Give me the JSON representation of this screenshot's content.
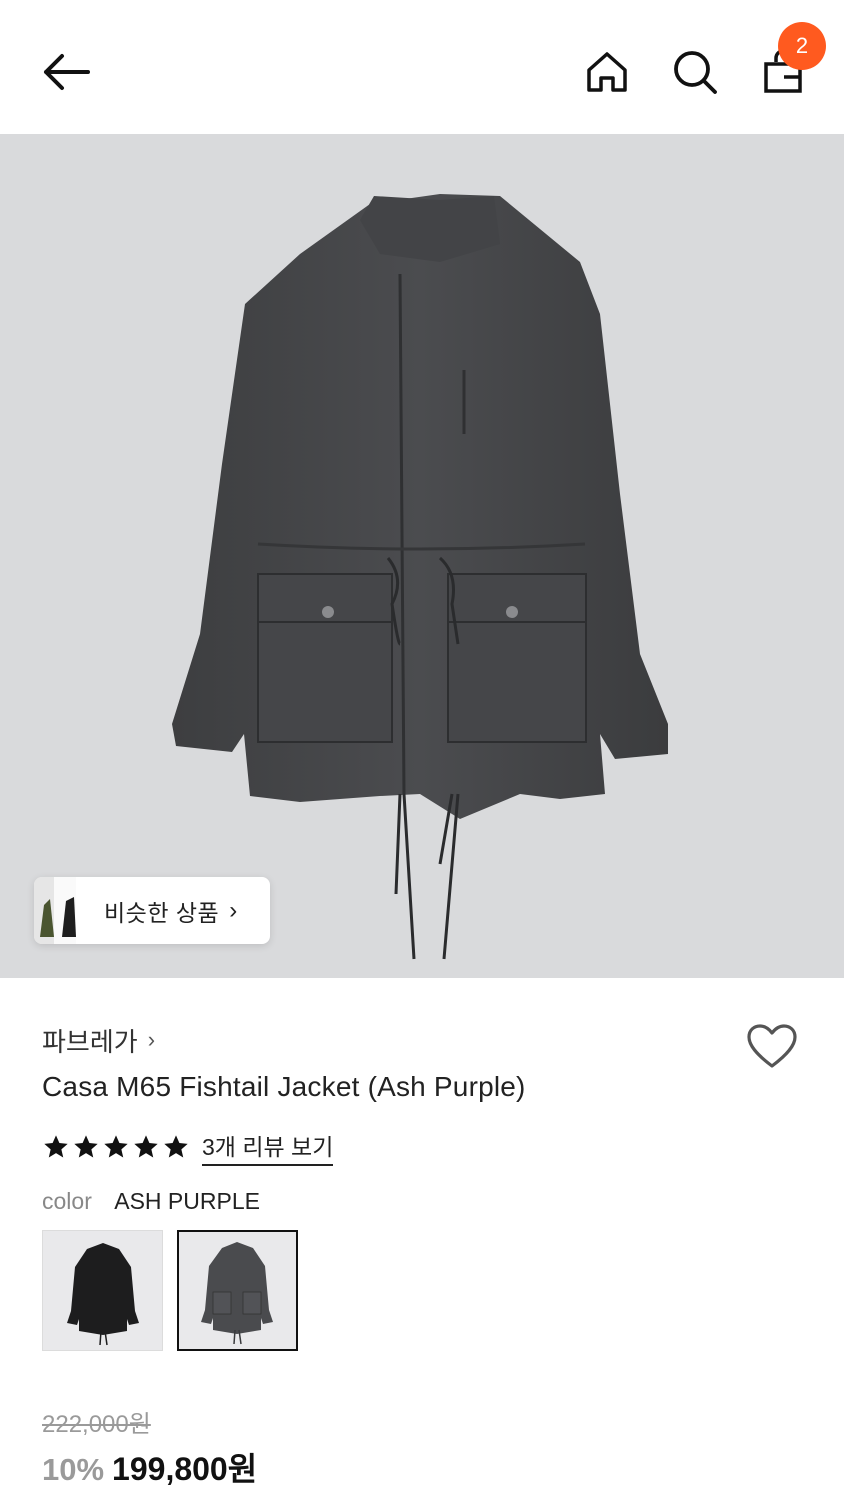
{
  "header": {
    "back_icon": "arrow-left-icon",
    "home_icon": "home-icon",
    "search_icon": "search-icon",
    "cart_icon": "shopping-bag-icon",
    "cart_count": "2",
    "badge_color": "#ff5a1f"
  },
  "hero": {
    "image": "jacket-photo",
    "similar_label": "비슷한 상품",
    "similar_chevron": "›"
  },
  "product": {
    "brand": "파브레가",
    "brand_chevron": "›",
    "name": "Casa M65 Fishtail Jacket (Ash Purple)",
    "rating_stars": 5,
    "review_link": "3개 리뷰 보기",
    "wishlist_icon": "heart-outline-icon"
  },
  "color": {
    "label": "color",
    "selected": "ASH PURPLE",
    "swatches": [
      {
        "name": "black",
        "selected": false
      },
      {
        "name": "ash-purple",
        "selected": true
      }
    ]
  },
  "pricing": {
    "original": "222,000원",
    "discount": "10%",
    "sale": "199,800원"
  }
}
